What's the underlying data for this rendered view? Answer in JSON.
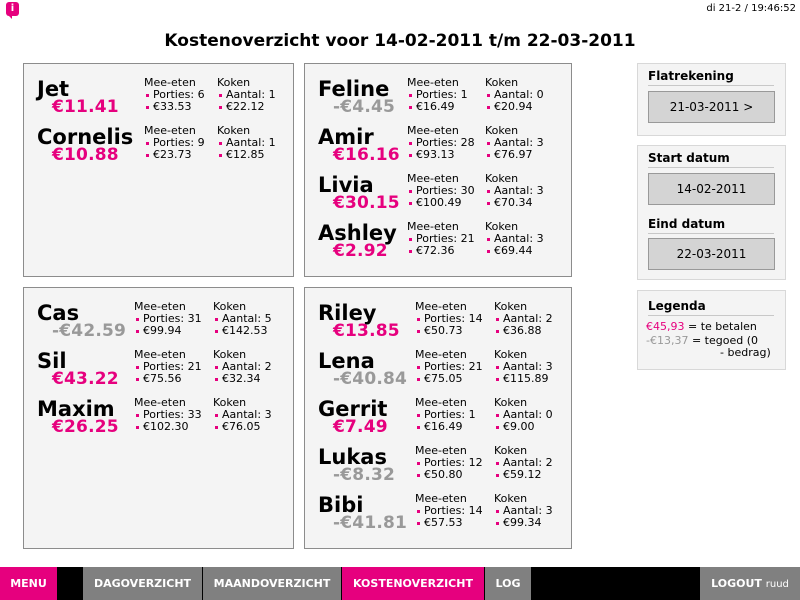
{
  "topbar": {
    "logo_glyph": "i",
    "datetime": "di 21-2 / 19:46:52"
  },
  "title": "Kostenoverzicht voor 14-02-2011 t/m 22-03-2011",
  "labels": {
    "meeeten": "Mee-eten",
    "koken": "Koken",
    "porties": "Porties:",
    "aantal": "Aantal:"
  },
  "groups": [
    {
      "people": [
        {
          "name": "Jet",
          "balance": "€11.41",
          "sign": "pos",
          "porties": "6",
          "meeeten_amount": "€33.53",
          "aantal": "1",
          "koken_amount": "€22.12"
        },
        {
          "name": "Cornelis",
          "balance": "€10.88",
          "sign": "pos",
          "porties": "9",
          "meeeten_amount": "€23.73",
          "aantal": "1",
          "koken_amount": "€12.85"
        }
      ]
    },
    {
      "people": [
        {
          "name": "Feline",
          "balance": "-€4.45",
          "sign": "neg",
          "porties": "1",
          "meeeten_amount": "€16.49",
          "aantal": "0",
          "koken_amount": "€20.94"
        },
        {
          "name": "Amir",
          "balance": "€16.16",
          "sign": "pos",
          "porties": "28",
          "meeeten_amount": "€93.13",
          "aantal": "3",
          "koken_amount": "€76.97"
        },
        {
          "name": "Livia",
          "balance": "€30.15",
          "sign": "pos",
          "porties": "30",
          "meeeten_amount": "€100.49",
          "aantal": "3",
          "koken_amount": "€70.34"
        },
        {
          "name": "Ashley",
          "balance": "€2.92",
          "sign": "pos",
          "porties": "21",
          "meeeten_amount": "€72.36",
          "aantal": "3",
          "koken_amount": "€69.44"
        }
      ]
    },
    {
      "people": [
        {
          "name": "Cas",
          "balance": "-€42.59",
          "sign": "neg",
          "porties": "31",
          "meeeten_amount": "€99.94",
          "aantal": "5",
          "koken_amount": "€142.53"
        },
        {
          "name": "Sil",
          "balance": "€43.22",
          "sign": "pos",
          "porties": "21",
          "meeeten_amount": "€75.56",
          "aantal": "2",
          "koken_amount": "€32.34"
        },
        {
          "name": "Maxim",
          "balance": "€26.25",
          "sign": "pos",
          "porties": "33",
          "meeeten_amount": "€102.30",
          "aantal": "3",
          "koken_amount": "€76.05"
        }
      ]
    },
    {
      "people": [
        {
          "name": "Riley",
          "balance": "€13.85",
          "sign": "pos",
          "porties": "14",
          "meeeten_amount": "€50.73",
          "aantal": "2",
          "koken_amount": "€36.88"
        },
        {
          "name": "Lena",
          "balance": "-€40.84",
          "sign": "neg",
          "porties": "21",
          "meeeten_amount": "€75.05",
          "aantal": "3",
          "koken_amount": "€115.89"
        },
        {
          "name": "Gerrit",
          "balance": "€7.49",
          "sign": "pos",
          "porties": "1",
          "meeeten_amount": "€16.49",
          "aantal": "0",
          "koken_amount": "€9.00"
        },
        {
          "name": "Lukas",
          "balance": "-€8.32",
          "sign": "neg",
          "porties": "12",
          "meeeten_amount": "€50.80",
          "aantal": "2",
          "koken_amount": "€59.12"
        },
        {
          "name": "Bibi",
          "balance": "-€41.81",
          "sign": "neg",
          "porties": "14",
          "meeeten_amount": "€57.53",
          "aantal": "3",
          "koken_amount": "€99.34"
        }
      ]
    }
  ],
  "sidebar": {
    "flatrekening": {
      "title": "Flatrekening",
      "button": "21-03-2011 >"
    },
    "start": {
      "title": "Start datum",
      "value": "14-02-2011"
    },
    "eind": {
      "title": "Eind datum",
      "value": "22-03-2011"
    },
    "legenda": {
      "title": "Legenda",
      "pos_example": "€45,93",
      "pos_text": "= te betalen",
      "neg_example": "-€13,37",
      "neg_text": "= tegoed (0",
      "neg_text2": "- bedrag)"
    }
  },
  "nav": {
    "menu": "MENU",
    "dag": "DAGOVERZICHT",
    "maand": "MAANDOVERZICHT",
    "kosten": "KOSTENOVERZICHT",
    "log": "LOG",
    "logout": "LOGOUT",
    "user": "ruud"
  },
  "colors": {
    "accent": "#e6007e",
    "negative": "#999999",
    "nav_gray": "#808080"
  }
}
